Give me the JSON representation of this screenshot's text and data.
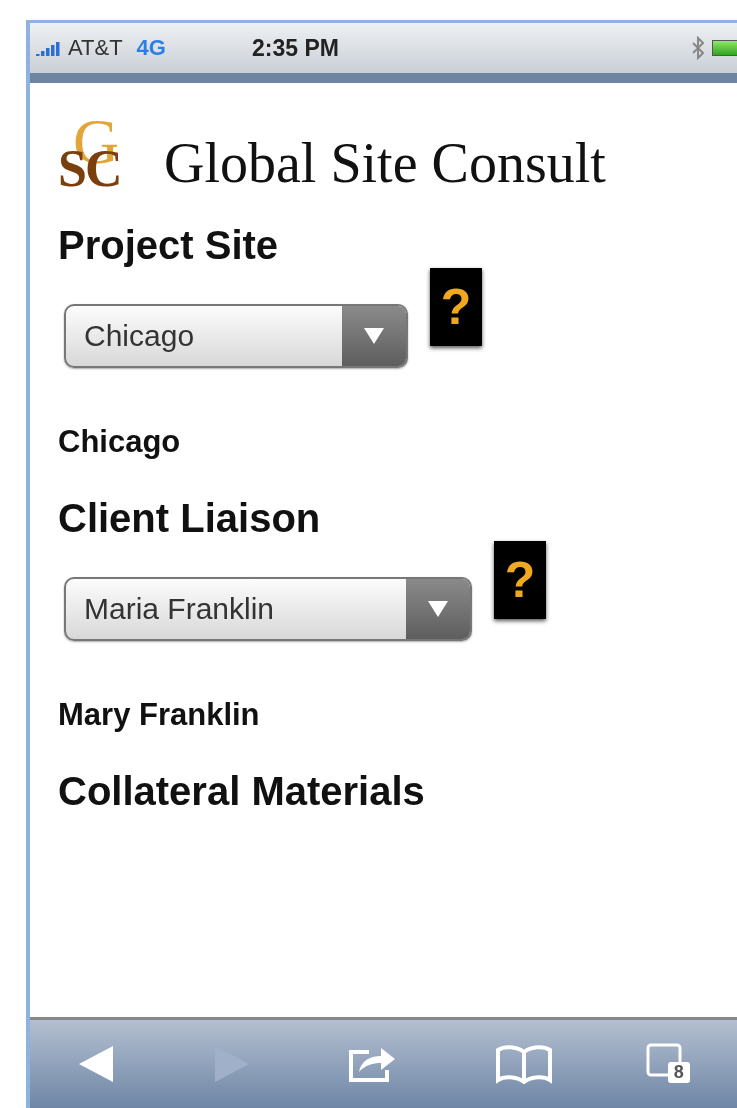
{
  "status_bar": {
    "carrier": "AT&T",
    "network": "4G",
    "time": "2:35 PM"
  },
  "logo": {
    "upper": "G",
    "lower": "SC",
    "title": "Global Site Consult"
  },
  "sections": [
    {
      "heading": "Project Site",
      "select": "Chicago",
      "help": "?",
      "result": "Chicago"
    },
    {
      "heading": "Client Liaison",
      "select": "Maria Franklin",
      "help": "?",
      "result": "Mary Franklin"
    },
    {
      "heading": "Collateral Materials"
    }
  ],
  "toolbar": {
    "back": {
      "disabled": false
    },
    "forward": {
      "disabled": true
    },
    "tab_count": "8"
  }
}
